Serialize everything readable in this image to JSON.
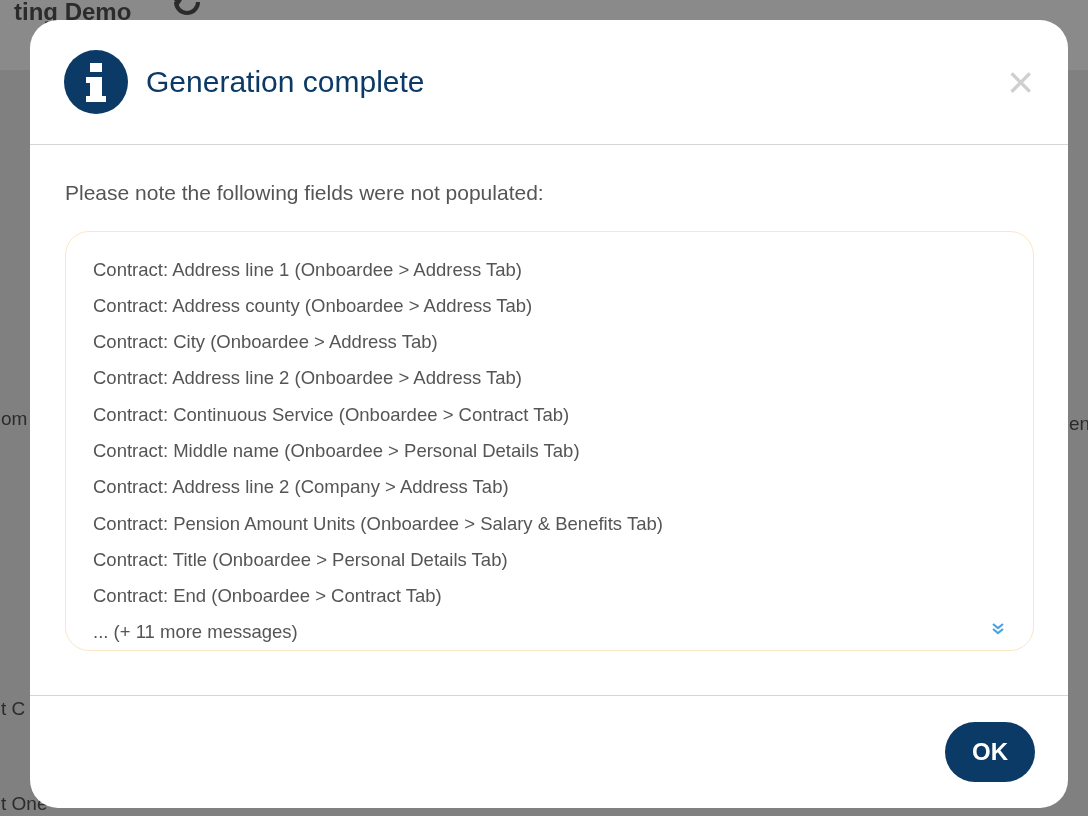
{
  "background": {
    "texts": [
      {
        "text": "ting Demo",
        "kind": "heading"
      },
      {
        "text": "om",
        "kind": "left"
      },
      {
        "text": "en",
        "kind": "right"
      },
      {
        "text": "t C",
        "kind": "left"
      },
      {
        "text": "t One",
        "kind": "left"
      }
    ]
  },
  "dialog": {
    "title": "Generation complete",
    "close": "×",
    "intro": "Please note the following fields were not populated:",
    "messages": [
      "Contract: Address line 1 (Onboardee > Address Tab)",
      "Contract: Address county (Onboardee > Address Tab)",
      "Contract: City (Onboardee > Address Tab)",
      "Contract: Address line 2 (Onboardee > Address Tab)",
      "Contract: Continuous Service (Onboardee > Contract Tab)",
      "Contract: Middle name (Onboardee > Personal Details Tab)",
      "Contract: Address line 2 (Company > Address Tab)",
      "Contract: Pension Amount Units (Onboardee > Salary & Benefits Tab)",
      "Contract: Title (Onboardee > Personal Details Tab)",
      "Contract: End (Onboardee > Contract Tab)"
    ],
    "more": "... (+ 11 more messages)",
    "buttons": [
      "OK"
    ]
  }
}
